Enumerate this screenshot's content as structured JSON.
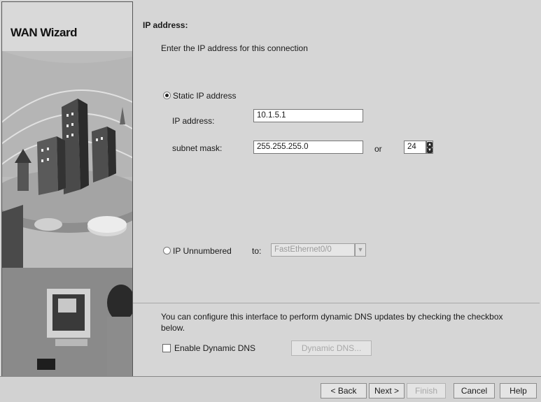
{
  "wizard_title": "WAN Wizard",
  "section_title": "IP address:",
  "instruction": "Enter the IP address for this connection",
  "static": {
    "radio_label": "Static IP address",
    "selected": true,
    "ip_label": "IP address:",
    "ip_value": "10.1.5.1",
    "mask_label": "subnet mask:",
    "mask_value": "255.255.255.0",
    "or_label": "or",
    "prefix_value": "24"
  },
  "unnumbered": {
    "radio_label": "IP Unnumbered",
    "to_label": "to:",
    "interface_value": "FastEthernet0/0"
  },
  "dns": {
    "note": "You can configure this interface to perform dynamic DNS updates by checking the checkbox below.",
    "checkbox_label": "Enable Dynamic DNS",
    "checked": false,
    "button_label": "Dynamic DNS..."
  },
  "footer": {
    "back": "< Back",
    "next": "Next >",
    "finish": "Finish",
    "cancel": "Cancel",
    "help": "Help"
  }
}
